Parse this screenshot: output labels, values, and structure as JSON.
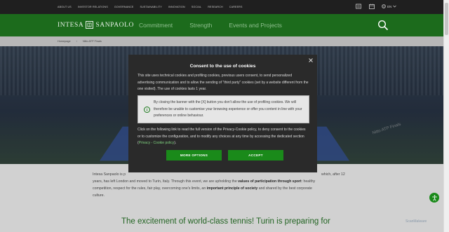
{
  "topbar": {
    "links": [
      "About us",
      "Investor relations",
      "Governance",
      "Sustainability",
      "Innovation",
      "Social",
      "Research",
      "Careers"
    ],
    "language": "EN",
    "icons": [
      "newspaper-icon",
      "calendar-icon",
      "globe-icon"
    ]
  },
  "nav": {
    "logo_text_left": "INTESA",
    "logo_text_right": "SANPAOLO",
    "items": [
      "Commitment",
      "Strength",
      "Events and Projects"
    ]
  },
  "breadcrumb": {
    "items": [
      "Homepage",
      "Nitto ATP Finals"
    ]
  },
  "hero": {
    "banner_text": "Nitto ATP Finals"
  },
  "content": {
    "line1_start": "Intesa Sanpaolo is p",
    "line1_end": "which, after 12",
    "line2_a": "years, has left London and moved to Turin, Italy. Through this event, we are upholding the ",
    "line2_bold": "values of participation through sport",
    "line2_b": ": healthy",
    "line3_a": "competition, respect for the rules, fair play, overcoming one's limits, an ",
    "line3_bold": "important principle of society",
    "line3_b": " and shared by the best corporate",
    "line4": "culture.",
    "headline": "The excitement of world-class tennis! Turin is preparing for"
  },
  "modal": {
    "title": "Consent to the use of cookies",
    "intro": "This site uses technical cookies and profiling cookies, previous users consent, to send personalized advertising communication and to allow the sending of \"third party\" cookies (set by a website different from the one visited). The use of cookies lasts 1 year.",
    "notice": "By closing the banner with the [X] button you don't allow the use of profiling cookies. We will therefore be unable to customise your browsing experience or offer you content in line with your preferences or online behaviour.",
    "more_text": "Click on the following link to read the full version of the Privacy-Cookie policy, to deny consent to the cookies or to customize the configuration, and to modify any choices at any time by accessing the dedicated section (",
    "more_link": "Privacy - Cookie policy",
    "more_end": ").",
    "btn_more": "MORE OPTIONS",
    "btn_accept": "ACCEPT"
  },
  "watermark": "ScanMalware",
  "colors": {
    "brand_green": "#1c6b1c",
    "button_green": "#1a8a1a",
    "modal_bg": "#2a2a2a"
  }
}
